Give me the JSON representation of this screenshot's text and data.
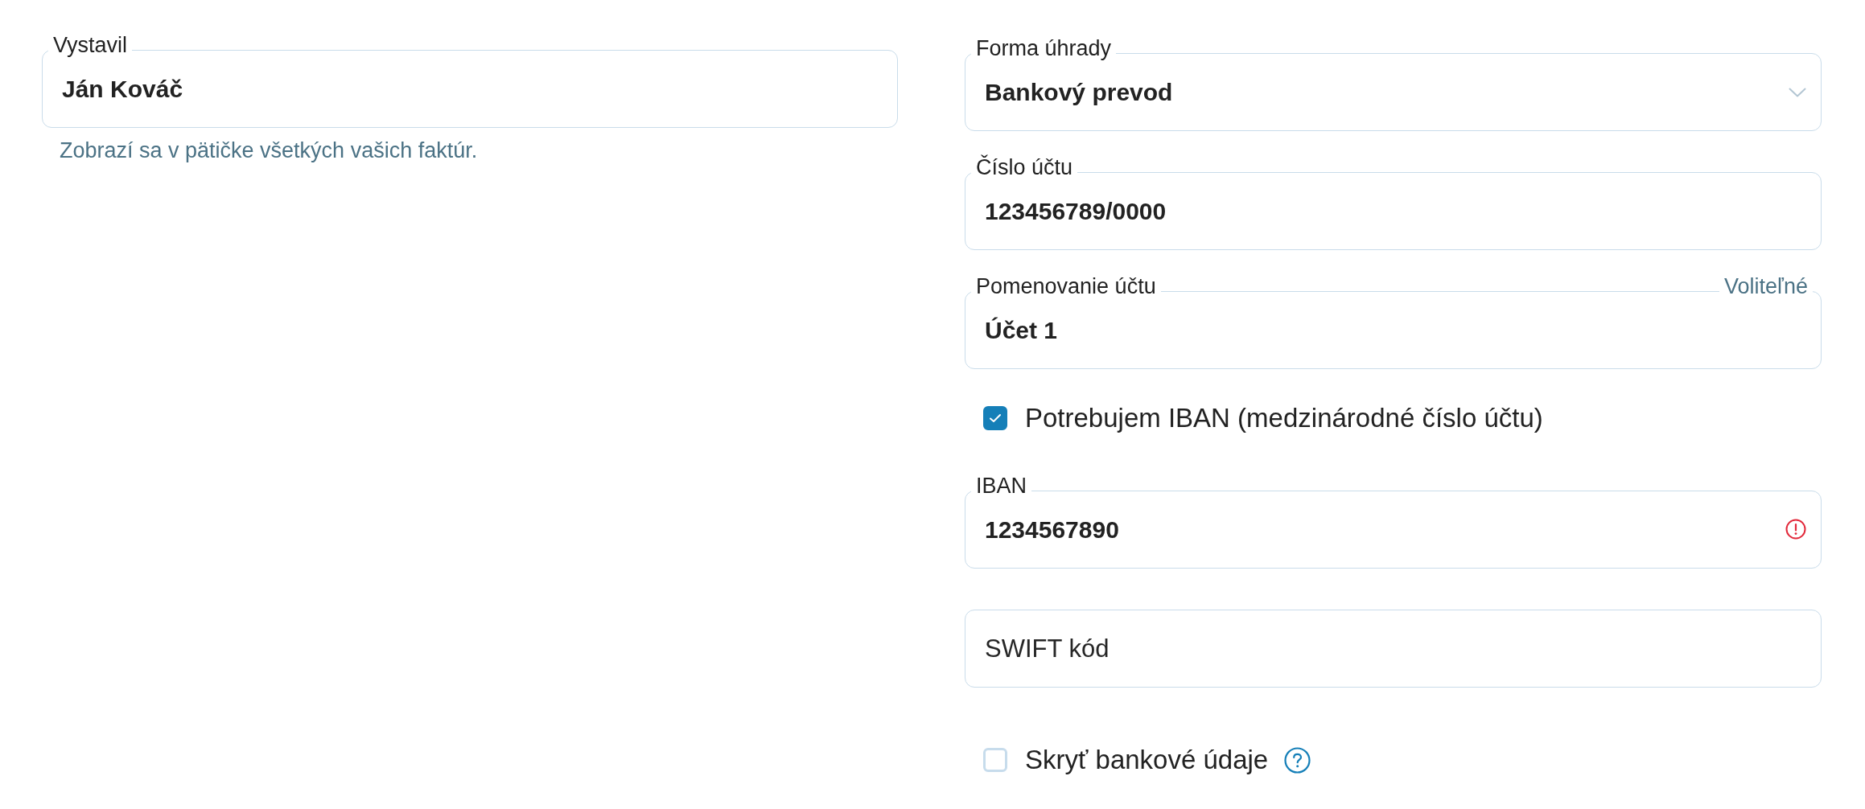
{
  "left": {
    "issuer": {
      "label": "Vystavil",
      "value": "Ján Kováč",
      "hint": "Zobrazí sa v pätičke všetkých vašich faktúr."
    }
  },
  "right": {
    "items": [
      {
        "kind": "select",
        "label": "Forma úhrady",
        "value": "Bankový prevod"
      },
      {
        "kind": "text",
        "label": "Číslo účtu",
        "value": "123456789/0000"
      },
      {
        "kind": "text",
        "label": "Pomenovanie účtu",
        "value": "Účet 1",
        "optional": "Voliteľné"
      },
      {
        "kind": "checkbox",
        "label": "Potrebujem IBAN (medzinárodné číslo účtu)",
        "checked": true
      },
      {
        "kind": "text",
        "label": "IBAN",
        "value": "1234567890",
        "error": true
      },
      {
        "kind": "text",
        "placeholder": "SWIFT kód"
      },
      {
        "kind": "checkbox",
        "label": "Skryť bankové údaje",
        "checked": false,
        "help": true
      }
    ]
  }
}
